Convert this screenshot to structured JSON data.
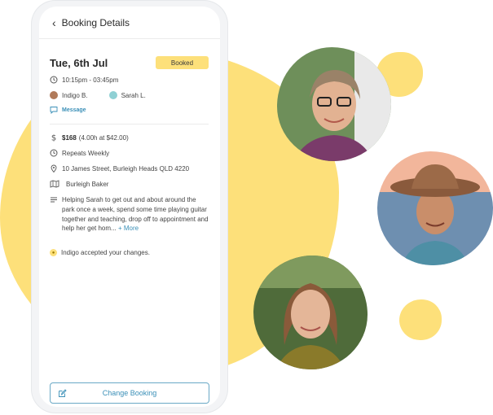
{
  "header": {
    "back_icon": "chevron-left-icon",
    "title": "Booking Details"
  },
  "booking": {
    "date": "Tue, 6th Jul",
    "status": "Booked",
    "time": "10:15pm - 03:45pm",
    "people": [
      {
        "name": "Indigo B.",
        "avatar": "avatar-indigo"
      },
      {
        "name": "Sarah L.",
        "avatar": "avatar-sarah"
      }
    ],
    "message_label": "Message",
    "price": "$168",
    "price_detail": "(4.00h at $42.00)",
    "repeat": "Repeats Weekly",
    "address": "10 James Street, Burleigh Heads QLD 4220",
    "activity": "Burleigh Baker",
    "description": "Helping Sarah to get out and about around the park once a week, spend some time playing guitar together and teaching, drop off to appointment and help her get hom...",
    "more_label": "+ More",
    "accepted_notice": "Indigo accepted your changes."
  },
  "actions": {
    "change_booking": "Change Booking"
  },
  "colors": {
    "accent_yellow": "#fde07a",
    "link_blue": "#3a8fb7"
  }
}
